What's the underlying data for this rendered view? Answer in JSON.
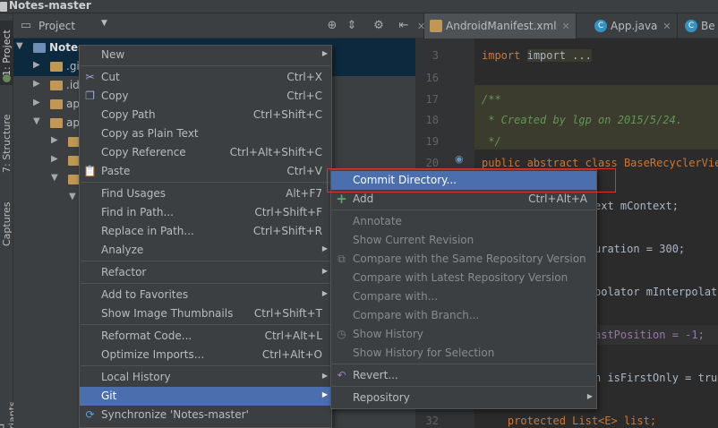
{
  "window": {
    "title": "Notes-master"
  },
  "side_tabs": {
    "project": "1: Project",
    "structure": "7: Structure",
    "captures": "Captures",
    "variants": "uild Variants"
  },
  "project_panel": {
    "title": "Project",
    "tree": [
      {
        "label": "Notes",
        "suffix": "",
        "level": 0,
        "expanded": true
      },
      {
        "label": ".gi",
        "level": 1,
        "expanded": false
      },
      {
        "label": ".id",
        "level": 1,
        "expanded": false
      },
      {
        "label": "ap",
        "level": 1,
        "expanded": false
      },
      {
        "label": "ap",
        "level": 1,
        "expanded": true
      },
      {
        "label": "",
        "level": 2,
        "expanded": false
      },
      {
        "label": "",
        "level": 2,
        "expanded": false
      },
      {
        "label": "",
        "level": 2,
        "expanded": true
      },
      {
        "label": "",
        "level": 3,
        "expanded": true
      }
    ]
  },
  "editor_tabs": [
    {
      "label": "AndroidManifest.xml",
      "icon": "xml-file-icon"
    },
    {
      "label": "App.java",
      "icon": "java-class-icon"
    },
    {
      "label": "Be",
      "icon": "java-class-icon"
    }
  ],
  "editor": {
    "lines": [
      {
        "no": "3",
        "text": "import ..."
      },
      {
        "no": "16",
        "text": ""
      },
      {
        "no": "17",
        "text": "/**"
      },
      {
        "no": "18",
        "text": " * Created by lgp on 2015/5/24."
      },
      {
        "no": "19",
        "text": " */"
      },
      {
        "no": "20",
        "text": "public abstract class BaseRecyclerView"
      },
      {
        "no": "",
        "text": "ext mContext;"
      },
      {
        "no": "",
        "text": "uration = 300;"
      },
      {
        "no": "",
        "text": "polator mInterpolator"
      },
      {
        "no": "",
        "text": "astPosition = -1;"
      },
      {
        "no": "",
        "text": "n isFirstOnly = true"
      },
      {
        "no": "32",
        "text": "    protected List<E> list;"
      }
    ]
  },
  "context_menu": {
    "items": [
      {
        "label": "New",
        "shortcut": "",
        "submenu": true,
        "icon": ""
      },
      {
        "label": "Cut",
        "shortcut": "Ctrl+X",
        "icon": "scissors-icon"
      },
      {
        "label": "Copy",
        "shortcut": "Ctrl+C",
        "icon": "copy-icon"
      },
      {
        "label": "Copy Path",
        "shortcut": "Ctrl+Shift+C",
        "icon": ""
      },
      {
        "label": "Copy as Plain Text",
        "shortcut": "",
        "icon": ""
      },
      {
        "label": "Copy Reference",
        "shortcut": "Ctrl+Alt+Shift+C",
        "icon": ""
      },
      {
        "label": "Paste",
        "shortcut": "Ctrl+V",
        "icon": "paste-icon"
      },
      {
        "label": "Find Usages",
        "shortcut": "Alt+F7",
        "icon": ""
      },
      {
        "label": "Find in Path...",
        "shortcut": "Ctrl+Shift+F",
        "icon": ""
      },
      {
        "label": "Replace in Path...",
        "shortcut": "Ctrl+Shift+R",
        "icon": ""
      },
      {
        "label": "Analyze",
        "shortcut": "",
        "submenu": true,
        "icon": ""
      },
      {
        "label": "Refactor",
        "shortcut": "",
        "submenu": true,
        "icon": ""
      },
      {
        "label": "Add to Favorites",
        "shortcut": "",
        "submenu": true,
        "icon": ""
      },
      {
        "label": "Show Image Thumbnails",
        "shortcut": "Ctrl+Shift+T",
        "icon": ""
      },
      {
        "label": "Reformat Code...",
        "shortcut": "Ctrl+Alt+L",
        "icon": ""
      },
      {
        "label": "Optimize Imports...",
        "shortcut": "Ctrl+Alt+O",
        "icon": ""
      },
      {
        "label": "Local History",
        "shortcut": "",
        "submenu": true,
        "icon": ""
      },
      {
        "label": "Git",
        "shortcut": "",
        "submenu": true,
        "icon": ""
      },
      {
        "label": "Synchronize 'Notes-master'",
        "shortcut": "",
        "icon": "sync-icon"
      }
    ]
  },
  "git_submenu": {
    "items": [
      {
        "label": "Commit Directory...",
        "shortcut": "",
        "enabled": true
      },
      {
        "label": "Add",
        "shortcut": "Ctrl+Alt+A",
        "enabled": true,
        "icon": "plus-icon"
      },
      {
        "label": "Annotate",
        "shortcut": "",
        "enabled": false
      },
      {
        "label": "Show Current Revision",
        "shortcut": "",
        "enabled": false
      },
      {
        "label": "Compare with the Same Repository Version",
        "shortcut": "",
        "enabled": false,
        "icon": "compare-icon"
      },
      {
        "label": "Compare with Latest Repository Version",
        "shortcut": "",
        "enabled": false
      },
      {
        "label": "Compare with...",
        "shortcut": "",
        "enabled": false
      },
      {
        "label": "Compare with Branch...",
        "shortcut": "",
        "enabled": false
      },
      {
        "label": "Show History",
        "shortcut": "",
        "enabled": false,
        "icon": "history-icon"
      },
      {
        "label": "Show History for Selection",
        "shortcut": "",
        "enabled": false
      },
      {
        "label": "Revert...",
        "shortcut": "",
        "enabled": true,
        "icon": "revert-icon"
      },
      {
        "label": "Repository",
        "shortcut": "",
        "enabled": true,
        "submenu": true
      }
    ]
  },
  "colors": {
    "accent": "#4b6eaf",
    "highlight_box": "#e03030",
    "menu_bg": "#3c3f41",
    "editor_bg": "#2b2b2b"
  }
}
